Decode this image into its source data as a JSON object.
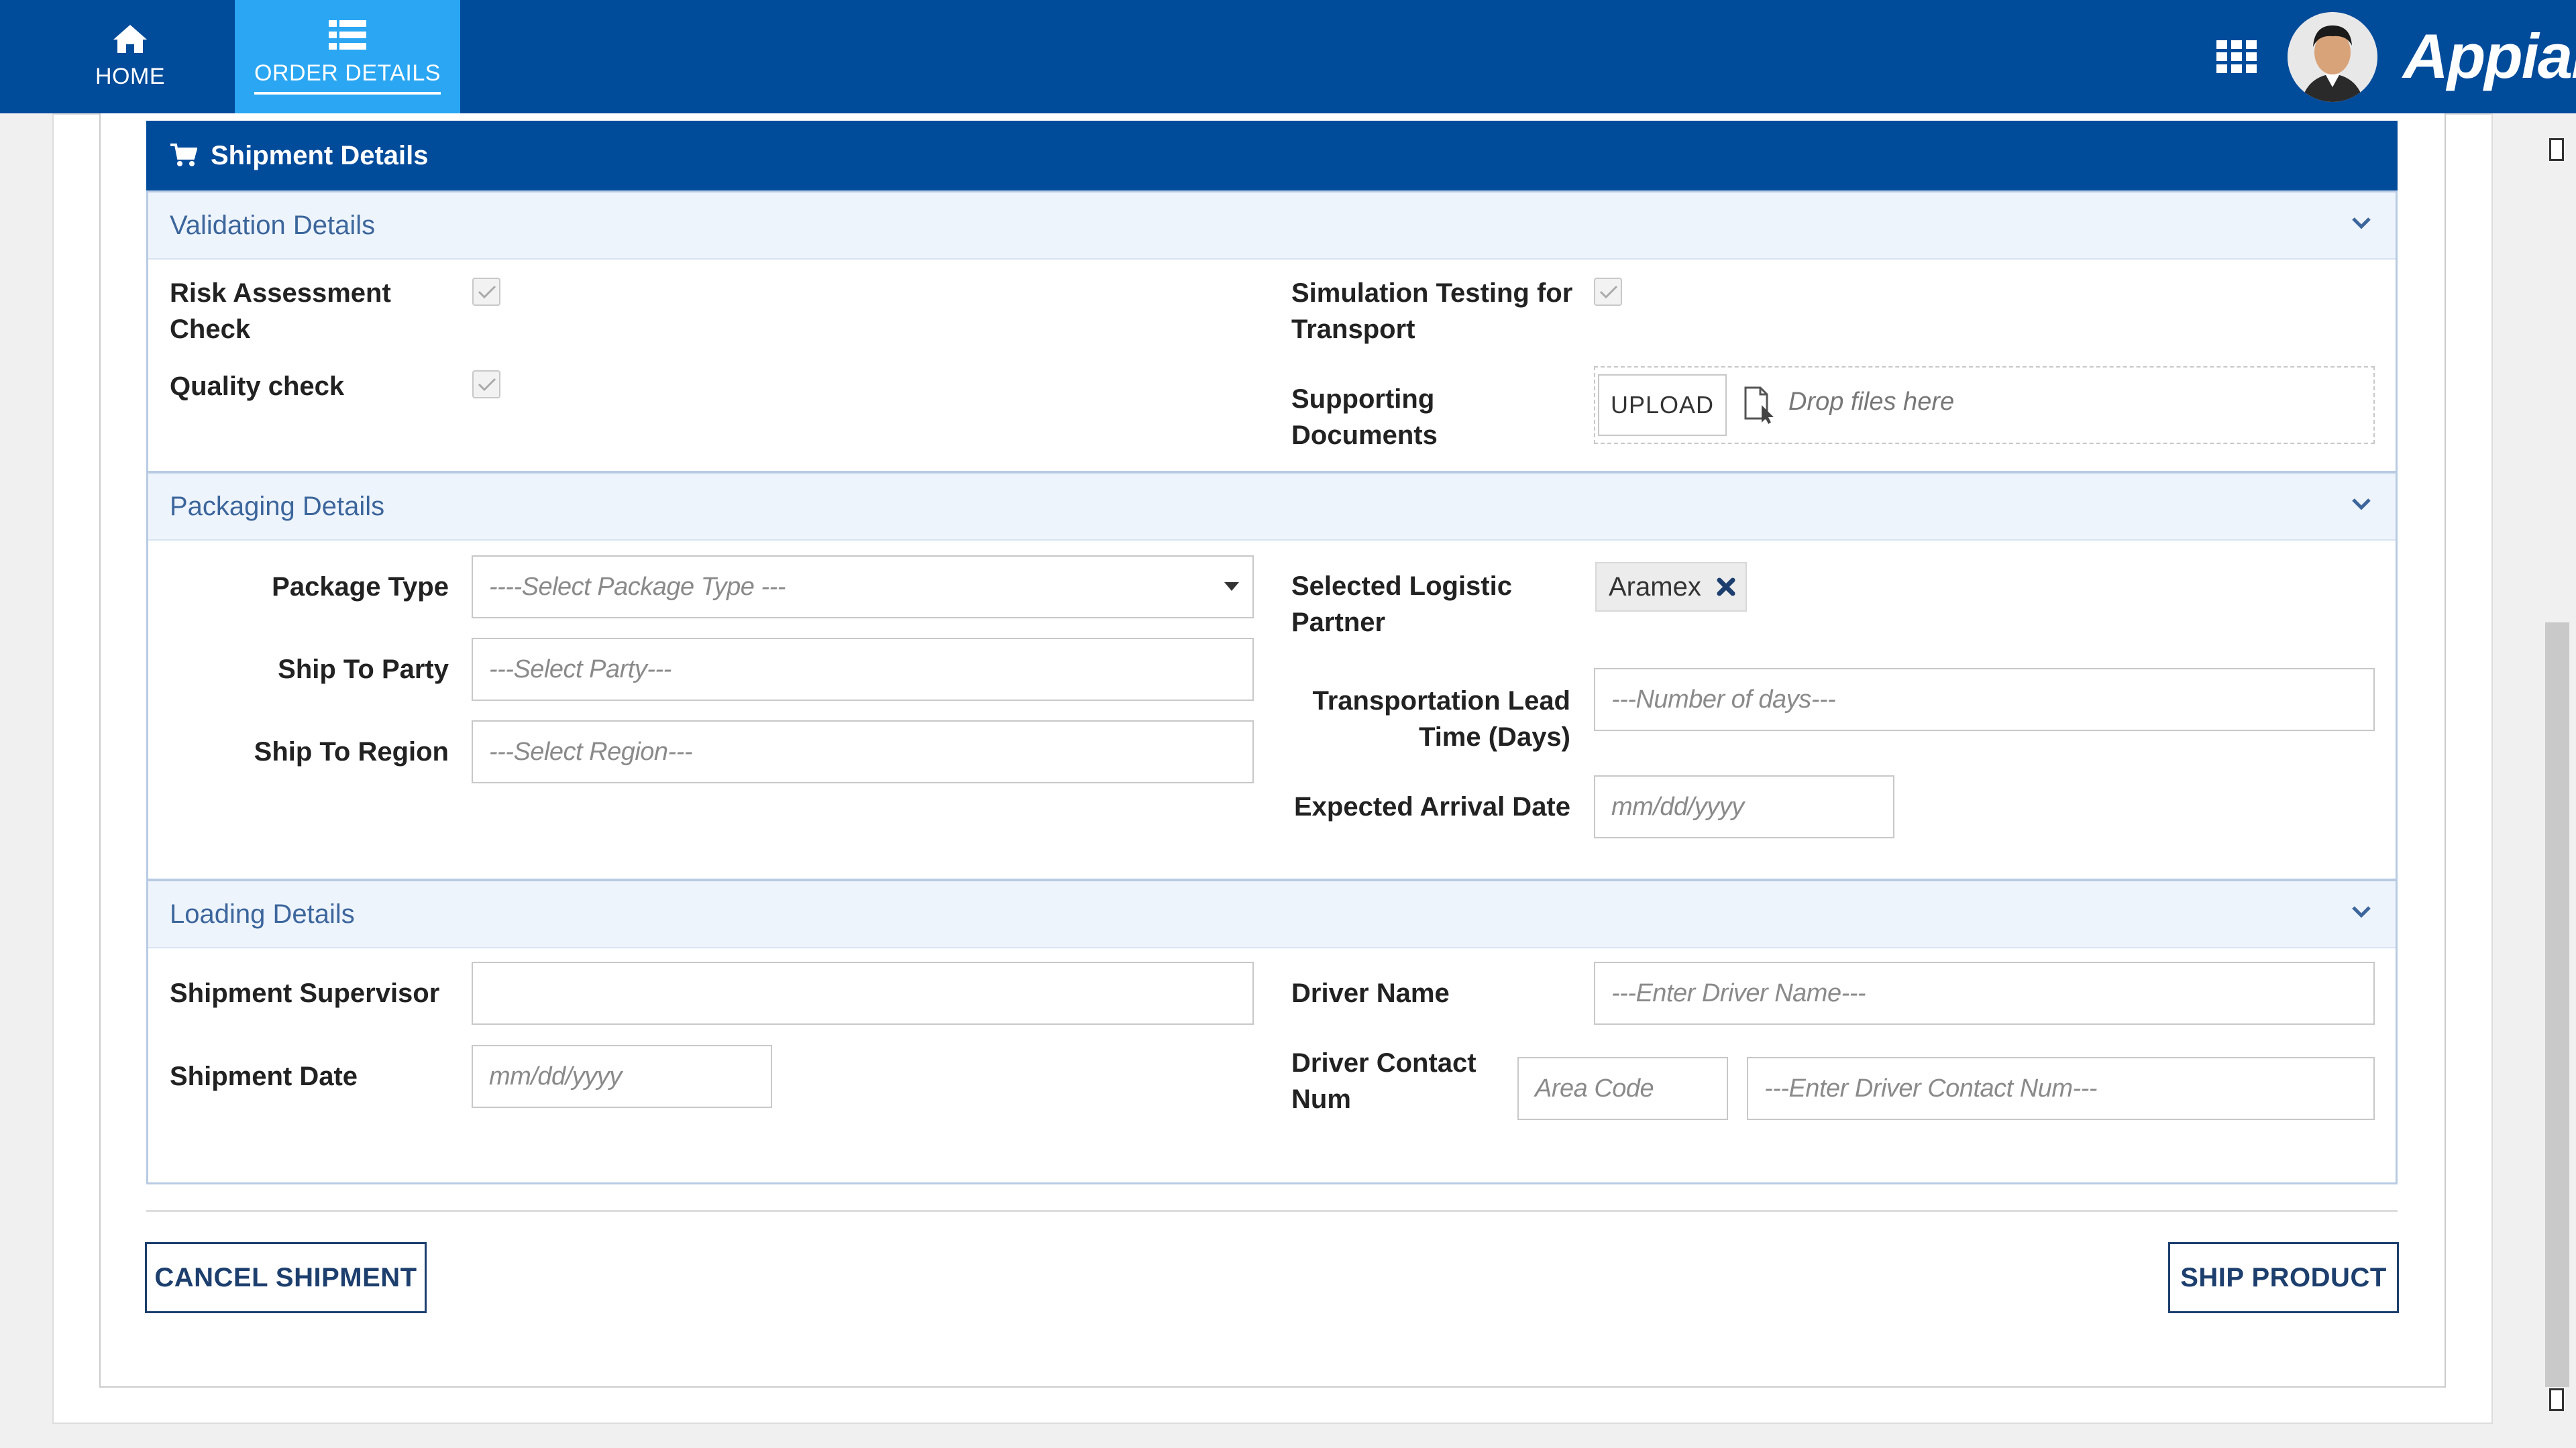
{
  "nav": {
    "home_label": "HOME",
    "order_details_label": "ORDER DETAILS",
    "logo_text": "Appian"
  },
  "shipment": {
    "header_title": "Shipment Details"
  },
  "validation": {
    "title": "Validation Details",
    "risk_assessment_label": "Risk Assessment Check",
    "risk_assessment_checked": true,
    "quality_check_label": "Quality check",
    "quality_check_checked": true,
    "simulation_testing_label": "Simulation Testing for Transport",
    "simulation_testing_checked": true,
    "supporting_docs_label": "Supporting Documents",
    "upload_label": "UPLOAD",
    "drop_text": "Drop files here"
  },
  "packaging": {
    "title": "Packaging Details",
    "package_type_label": "Package Type",
    "package_type_placeholder": "----Select Package Type ---",
    "ship_to_party_label": "Ship To Party",
    "ship_to_party_placeholder": "---Select Party---",
    "ship_to_region_label": "Ship To Region",
    "ship_to_region_placeholder": "---Select Region---",
    "logistic_partner_label": "Selected Logistic Partner",
    "logistic_partner_value": "Aramex",
    "lead_time_label": "Transportation Lead Time (Days)",
    "lead_time_placeholder": "---Number of days---",
    "arrival_date_label": "Expected Arrival Date",
    "arrival_date_placeholder": "mm/dd/yyyy"
  },
  "loading": {
    "title": "Loading Details",
    "supervisor_label": "Shipment Supervisor",
    "supervisor_value": "",
    "shipment_date_label": "Shipment Date",
    "shipment_date_placeholder": "mm/dd/yyyy",
    "driver_name_label": "Driver Name",
    "driver_name_placeholder": "---Enter Driver Name---",
    "driver_contact_label": "Driver Contact Num",
    "area_code_placeholder": "Area Code",
    "contact_num_placeholder": "---Enter Driver Contact Num---"
  },
  "actions": {
    "cancel_label": "CANCEL SHIPMENT",
    "ship_label": "SHIP PRODUCT"
  },
  "colors": {
    "brand_blue": "#014b9b",
    "active_tab": "#2aa6f3",
    "section_bg": "#eef4fc",
    "section_text": "#3c669c"
  }
}
